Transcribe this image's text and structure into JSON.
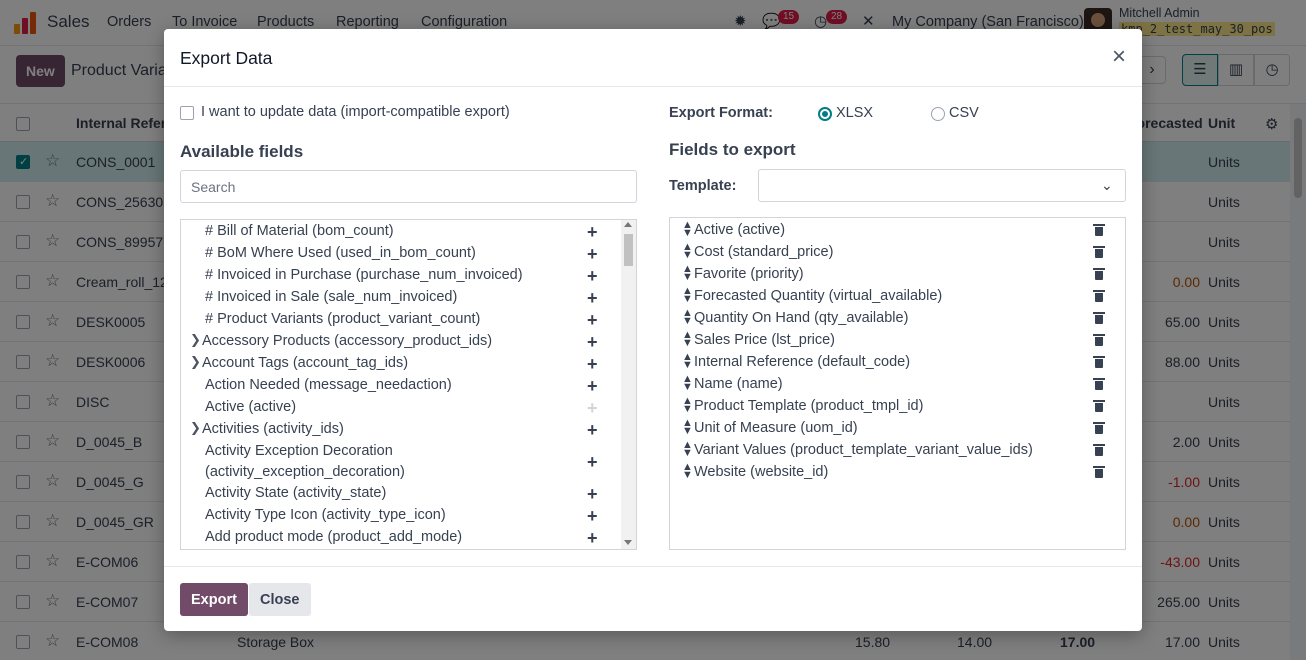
{
  "navbar": {
    "brand": "Sales",
    "menu": [
      "Orders",
      "To Invoice",
      "Products",
      "Reporting",
      "Configuration"
    ],
    "messages_count": "15",
    "activities_count": "28",
    "company": "My Company (San Francisco)",
    "user_name": "Mitchell Admin",
    "database": "kmp_2_test_may_30_pos"
  },
  "control_panel": {
    "new_label": "New",
    "title": "Product Variants"
  },
  "list": {
    "headers": {
      "internal_ref": "Internal Reference",
      "forecasted": "Forecasted",
      "unit": "Unit"
    },
    "rows": [
      {
        "code": "CONS_0001",
        "name": "",
        "c1": "",
        "c2": "",
        "c3": "",
        "forecast": "",
        "unit": "Units",
        "selected": true
      },
      {
        "code": "CONS_25630",
        "name": "",
        "c1": "",
        "c2": "",
        "c3": "",
        "forecast": "",
        "unit": "Units"
      },
      {
        "code": "CONS_89957",
        "name": "",
        "c1": "",
        "c2": "",
        "c3": "",
        "forecast": "",
        "unit": "Units"
      },
      {
        "code": "Cream_roll_12",
        "name": "",
        "c1": "",
        "c2": "",
        "c3": "",
        "forecast": "0.00",
        "unit": "Units",
        "fc_color": "#b45309"
      },
      {
        "code": "DESK0005",
        "name": "",
        "c1": "",
        "c2": "",
        "c3": "",
        "forecast": "65.00",
        "unit": "Units"
      },
      {
        "code": "DESK0006",
        "name": "",
        "c1": "",
        "c2": "",
        "c3": "",
        "forecast": "88.00",
        "unit": "Units"
      },
      {
        "code": "DISC",
        "name": "",
        "c1": "",
        "c2": "",
        "c3": "",
        "forecast": "",
        "unit": "Units"
      },
      {
        "code": "D_0045_B",
        "name": "",
        "c1": "",
        "c2": "",
        "c3": "",
        "forecast": "2.00",
        "unit": "Units"
      },
      {
        "code": "D_0045_G",
        "name": "",
        "c1": "",
        "c2": "",
        "c3": "",
        "forecast": "-1.00",
        "unit": "Units",
        "fc_color": "#dc2626"
      },
      {
        "code": "D_0045_GR",
        "name": "",
        "c1": "",
        "c2": "",
        "c3": "",
        "forecast": "0.00",
        "unit": "Units",
        "fc_color": "#b45309"
      },
      {
        "code": "E-COM06",
        "name": "",
        "c1": "",
        "c2": "",
        "c3": "",
        "forecast": "-43.00",
        "unit": "Units",
        "fc_color": "#dc2626"
      },
      {
        "code": "E-COM07",
        "name": "",
        "c1": "",
        "c2": "",
        "c3": "",
        "forecast": "265.00",
        "unit": "Units"
      },
      {
        "code": "E-COM08",
        "name": "Storage Box",
        "c1": "15.80",
        "c2": "14.00",
        "c3": "17.00",
        "forecast": "17.00",
        "unit": "Units"
      }
    ]
  },
  "modal": {
    "title": "Export Data",
    "update_checkbox_label": "I want to update data (import-compatible export)",
    "available_fields_heading": "Available fields",
    "search_placeholder": "Search",
    "available_fields": [
      {
        "label": "# Bill of Material (bom_count)",
        "expand": false,
        "added": false
      },
      {
        "label": "# BoM Where Used (used_in_bom_count)",
        "expand": false,
        "added": false
      },
      {
        "label": "# Invoiced in Purchase (purchase_num_invoiced)",
        "expand": false,
        "added": false
      },
      {
        "label": "# Invoiced in Sale (sale_num_invoiced)",
        "expand": false,
        "added": false
      },
      {
        "label": "# Product Variants (product_variant_count)",
        "expand": false,
        "added": false
      },
      {
        "label": "Accessory Products (accessory_product_ids)",
        "expand": true,
        "added": false
      },
      {
        "label": "Account Tags (account_tag_ids)",
        "expand": true,
        "added": false
      },
      {
        "label": "Action Needed (message_needaction)",
        "expand": false,
        "added": false
      },
      {
        "label": "Active (active)",
        "expand": false,
        "added": true
      },
      {
        "label": "Activities (activity_ids)",
        "expand": true,
        "added": false
      },
      {
        "label": "Activity Exception Decoration",
        "label2": "(activity_exception_decoration)",
        "expand": false,
        "added": false
      },
      {
        "label": "Activity State (activity_state)",
        "expand": false,
        "added": false
      },
      {
        "label": "Activity Type Icon (activity_type_icon)",
        "expand": false,
        "added": false
      },
      {
        "label": "Add product mode (product_add_mode)",
        "expand": false,
        "added": false
      }
    ],
    "export_format_label": "Export Format:",
    "formats": [
      {
        "label": "XLSX",
        "selected": true
      },
      {
        "label": "CSV",
        "selected": false
      }
    ],
    "fields_to_export_heading": "Fields to export",
    "template_label": "Template:",
    "template_value": "",
    "export_fields": [
      "Active (active)",
      "Cost (standard_price)",
      "Favorite (priority)",
      "Forecasted Quantity (virtual_available)",
      "Quantity On Hand (qty_available)",
      "Sales Price (lst_price)",
      "Internal Reference (default_code)",
      "Name (name)",
      "Product Template (product_tmpl_id)",
      "Unit of Measure (uom_id)",
      "Variant Values (product_template_variant_value_ids)",
      "Website (website_id)"
    ],
    "export_button": "Export",
    "close_button": "Close"
  },
  "colors": {
    "brand": "#714b67",
    "accent": "#017e84",
    "danger": "#e11d48"
  }
}
